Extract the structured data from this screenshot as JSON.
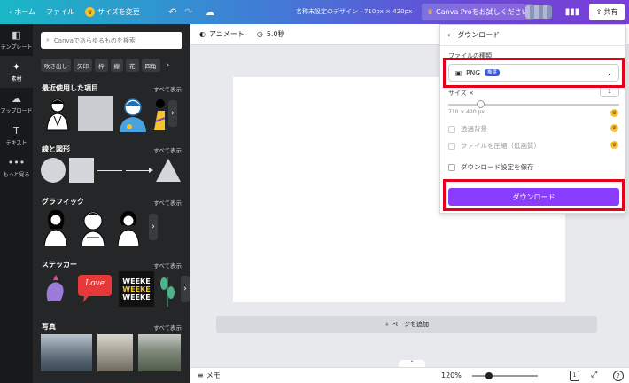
{
  "topbar": {
    "home_label": "ホーム",
    "file_label": "ファイル",
    "resize_label": "サイズを変更",
    "doc_title": "名称未設定のデザイン - 710px × 420px",
    "pro_label": "Canva Proをお試しください",
    "share_label": "共有"
  },
  "rail": [
    {
      "icon": "template-icon",
      "glyph": "◧",
      "label": "テンプレート"
    },
    {
      "icon": "elements-icon",
      "glyph": "✦",
      "label": "素材"
    },
    {
      "icon": "upload-icon",
      "glyph": "☁",
      "label": "アップロード"
    },
    {
      "icon": "text-icon",
      "glyph": "T",
      "label": "テキスト"
    },
    {
      "icon": "more-icon",
      "glyph": "•••",
      "label": "もっと見る"
    }
  ],
  "panel": {
    "search_placeholder": "Canvaであらゆるものを検索",
    "chips": [
      "吹き出し",
      "矢印",
      "枠",
      "線",
      "花",
      "四角"
    ],
    "see_all": "すべて表示",
    "sections": {
      "recent": "最近使用した項目",
      "shapes": "線と図形",
      "graphics": "グラフィック",
      "stickers": "ステッカー",
      "photos": "写真"
    },
    "sticker_love": "Love",
    "sticker_weekend": "WEEKE"
  },
  "editbar": {
    "animate_label": "アニメート",
    "duration_label": "5.0秒"
  },
  "canvas": {
    "add_page_label": "+ ページを追加"
  },
  "bottombar": {
    "notes_label": "メモ",
    "zoom_label": "120%",
    "zoom_level": 0.25,
    "page_count": "1"
  },
  "download": {
    "header": "ダウンロード",
    "file_type_label": "ファイルの種類",
    "file_type_value": "PNG",
    "recommended_badge": "推奨",
    "size_label": "サイズ ×",
    "size_value": "1",
    "size_level": 0.19,
    "dimensions": "710 × 420 px",
    "transparent_label": "透過背景",
    "compress_label": "ファイルを圧縮（低画質）",
    "save_settings_label": "ダウンロード設定を保存",
    "button_label": "ダウンロード"
  },
  "colors": {
    "accent": "#8b3dff",
    "highlight": "#e6001a",
    "crown": "#f5c22b"
  }
}
